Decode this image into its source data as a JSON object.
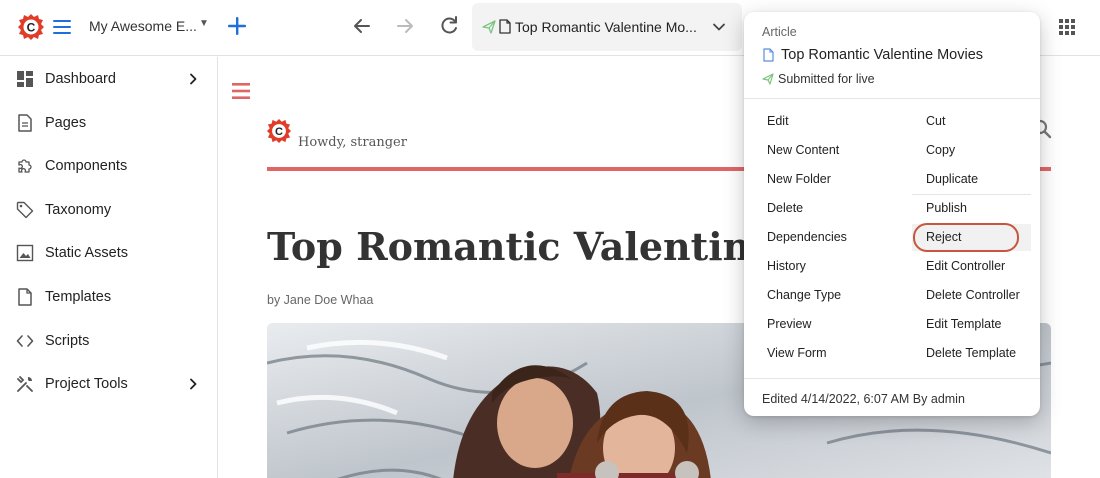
{
  "toolbar": {
    "site_name": "My Awesome E...",
    "path_title": "Top Romantic Valentine Mo..."
  },
  "sidebar": {
    "items": [
      {
        "label": "Dashboard",
        "icon": "dashboard-icon",
        "has_chevron": true
      },
      {
        "label": "Pages",
        "icon": "pages-icon",
        "has_chevron": false
      },
      {
        "label": "Components",
        "icon": "puzzle-icon",
        "has_chevron": false
      },
      {
        "label": "Taxonomy",
        "icon": "tag-icon",
        "has_chevron": false
      },
      {
        "label": "Static Assets",
        "icon": "image-icon",
        "has_chevron": false
      },
      {
        "label": "Templates",
        "icon": "template-icon",
        "has_chevron": false
      },
      {
        "label": "Scripts",
        "icon": "code-icon",
        "has_chevron": false
      },
      {
        "label": "Project Tools",
        "icon": "tools-icon",
        "has_chevron": true
      }
    ]
  },
  "preview": {
    "greeting": "Howdy, stranger",
    "article_title": "Top Romantic Valentine M",
    "byline": "by Jane Doe Whaa"
  },
  "popover": {
    "type": "Article",
    "title": "Top Romantic Valentine Movies",
    "status": "Submitted for live",
    "left_actions": [
      "Edit",
      "New Content",
      "New Folder",
      "Delete",
      "Dependencies",
      "History",
      "Change Type",
      "Preview",
      "View Form"
    ],
    "right_actions": [
      "Cut",
      "Copy",
      "Duplicate",
      "Publish",
      "Reject",
      "Edit Controller",
      "Delete Controller",
      "Edit Template",
      "Delete Template"
    ],
    "footer": "Edited 4/14/2022, 6:07 AM By admin"
  },
  "colors": {
    "brand_red": "#e03c28",
    "accent_blue": "#1e6fd9",
    "preview_red": "#e06666",
    "status_green": "#7cc47f",
    "highlight_ring": "#c8553d"
  }
}
